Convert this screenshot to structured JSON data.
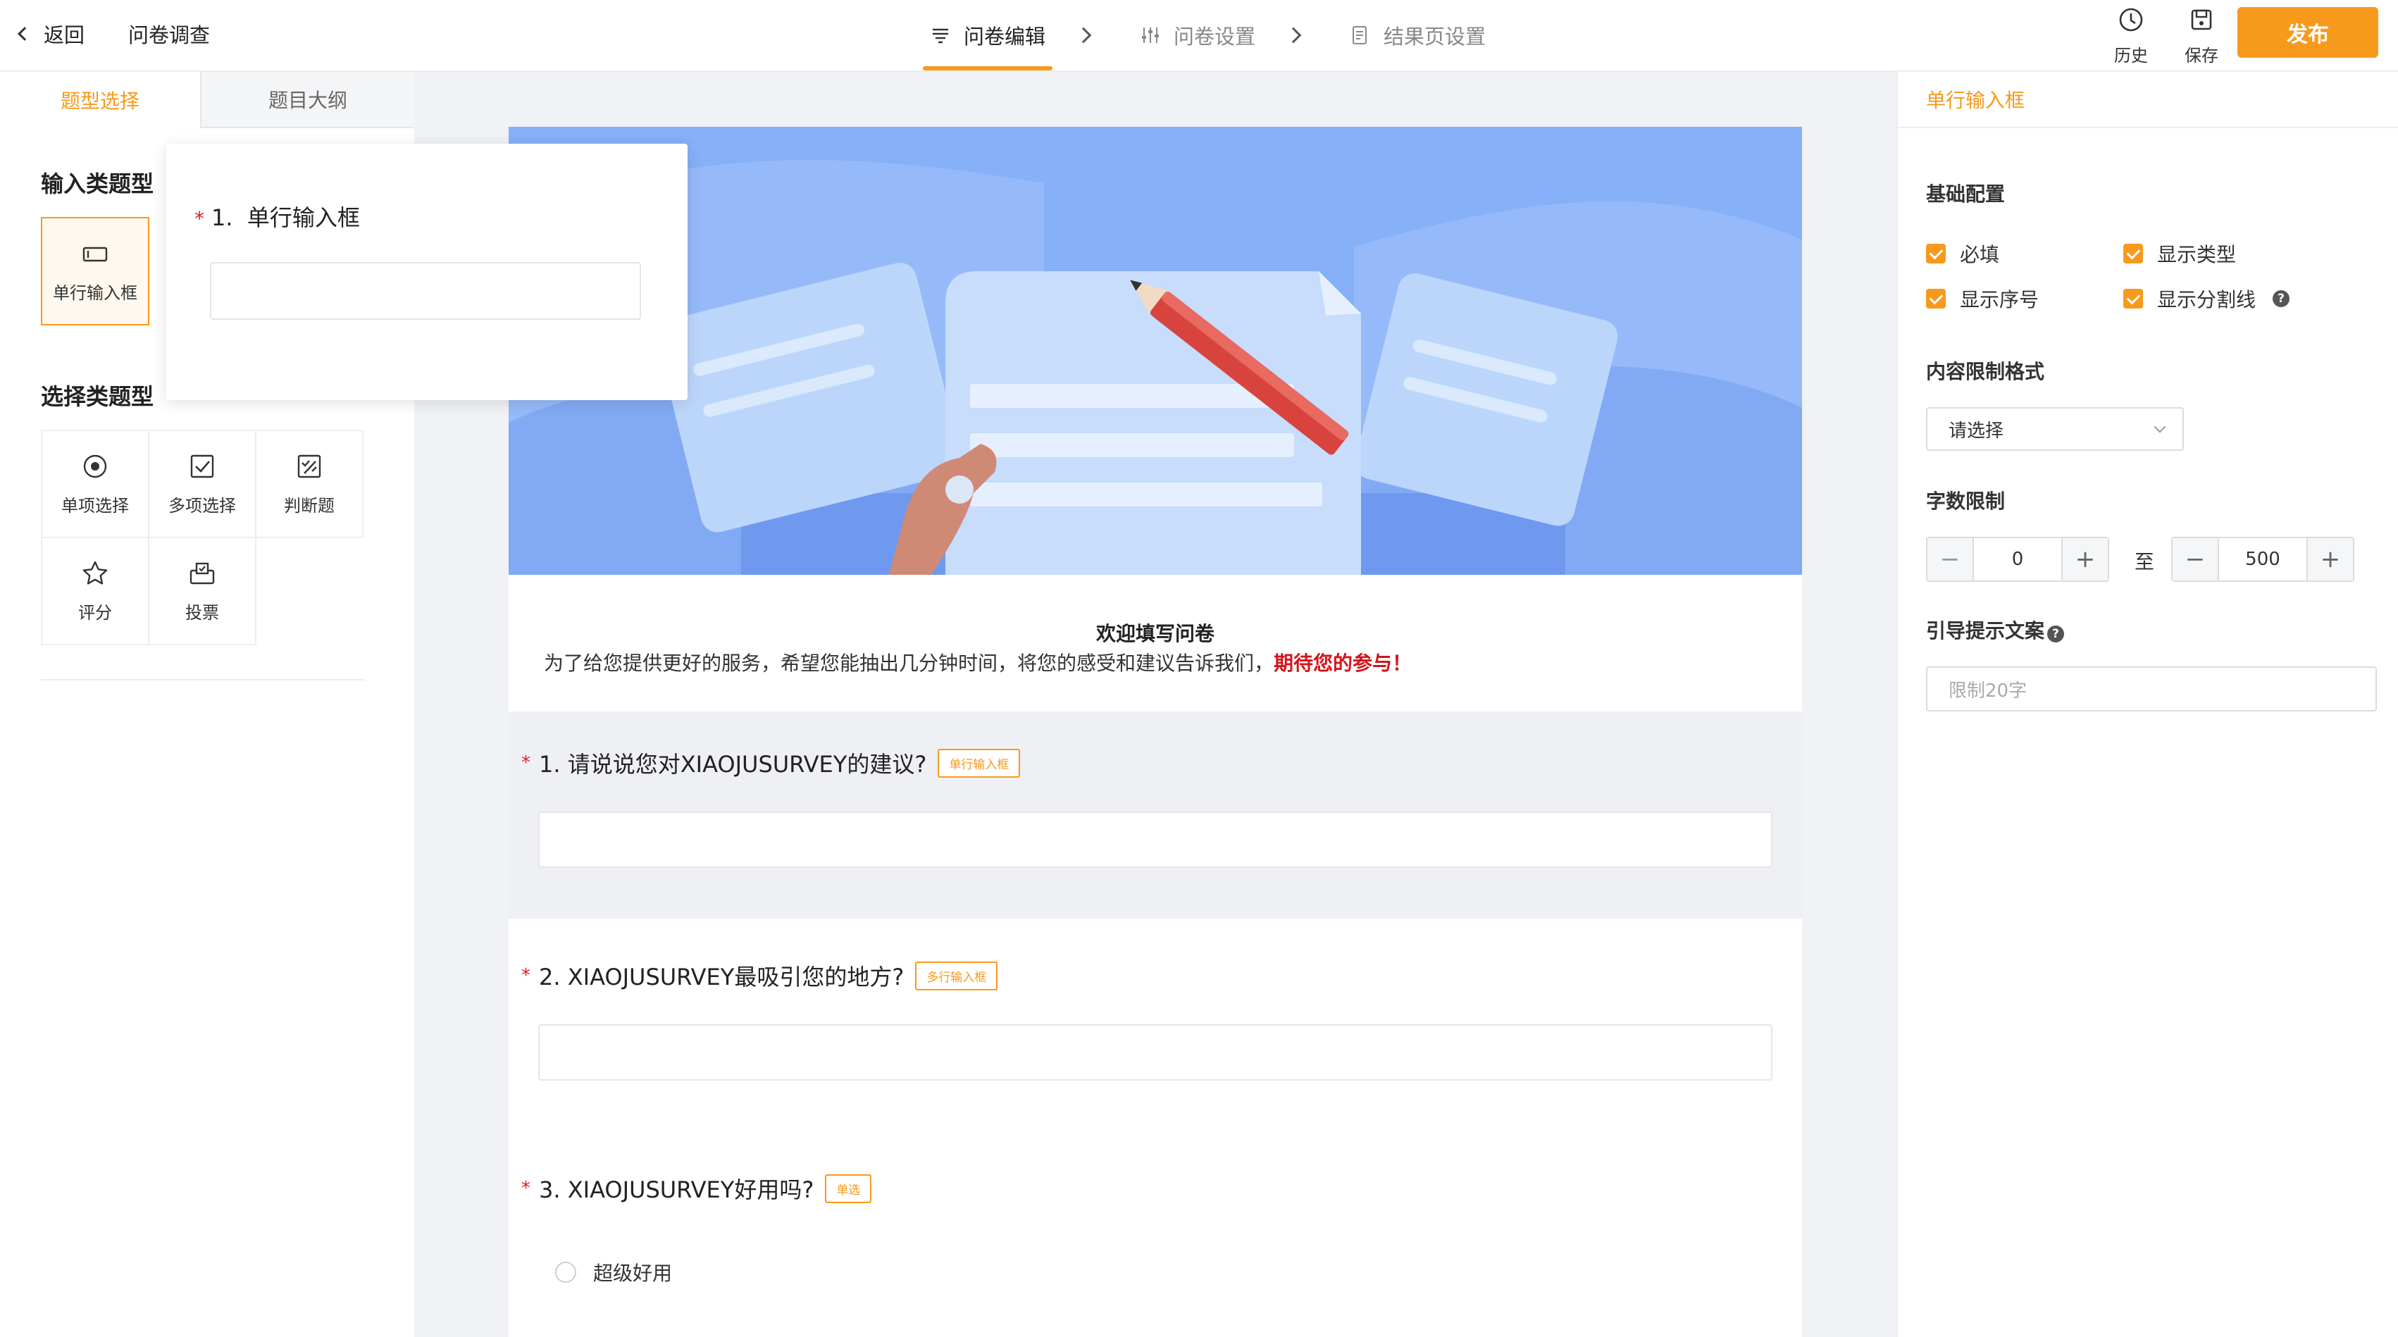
{
  "header": {
    "back_label": "返回",
    "survey_title": "问卷调查",
    "steps": [
      {
        "label": "问卷编辑",
        "active": true
      },
      {
        "label": "问卷设置",
        "active": false
      },
      {
        "label": "结果页设置",
        "active": false
      }
    ],
    "history_label": "历史",
    "save_label": "保存",
    "publish_label": "发布"
  },
  "left_panel": {
    "tabs": [
      "题型选择",
      "题目大纲"
    ],
    "input_section_title": "输入类题型",
    "input_types": [
      {
        "label": "单行输入框",
        "icon": "single-line-input-icon"
      }
    ],
    "choice_section_title": "选择类题型",
    "choice_types": [
      {
        "label": "单项选择",
        "icon": "radio-icon"
      },
      {
        "label": "多项选择",
        "icon": "checkbox-icon"
      },
      {
        "label": "判断题",
        "icon": "judge-icon"
      },
      {
        "label": "评分",
        "icon": "star-icon"
      },
      {
        "label": "投票",
        "icon": "vote-icon"
      }
    ]
  },
  "preview_popup": {
    "number": "1.",
    "title": "单行输入框"
  },
  "canvas": {
    "welcome_title": "欢迎填写问卷",
    "welcome_desc": "为了给您提供更好的服务，希望您能抽出几分钟时间，将您的感受和建议告诉我们，",
    "welcome_highlight": "期待您的参与！",
    "questions": [
      {
        "title": "1. 请说说您对XIAOJUSURVEY的建议?",
        "type_badge": "单行输入框",
        "required": true
      },
      {
        "title": "2. XIAOJUSURVEY最吸引您的地方?",
        "type_badge": "多行输入框",
        "required": true
      },
      {
        "title": "3. XIAOJUSURVEY好用吗?",
        "type_badge": "单选",
        "required": true,
        "options": [
          "超级好用"
        ]
      }
    ]
  },
  "right_panel": {
    "title": "单行输入框",
    "basic_config_label": "基础配置",
    "checkboxes": [
      {
        "label": "必填",
        "checked": true
      },
      {
        "label": "显示类型",
        "checked": true
      },
      {
        "label": "显示序号",
        "checked": true
      },
      {
        "label": "显示分割线",
        "checked": true
      }
    ],
    "format_label": "内容限制格式",
    "format_placeholder": "请选择",
    "length_label": "字数限制",
    "min_value": "0",
    "to_label": "至",
    "max_value": "500",
    "hint_label": "引导提示文案",
    "hint_placeholder": "限制20字"
  },
  "colors": {
    "accent": "#f79a1c",
    "required_star": "#e02020",
    "highlight_red": "#d4141c",
    "banner_blue": "#7ea9f5"
  }
}
